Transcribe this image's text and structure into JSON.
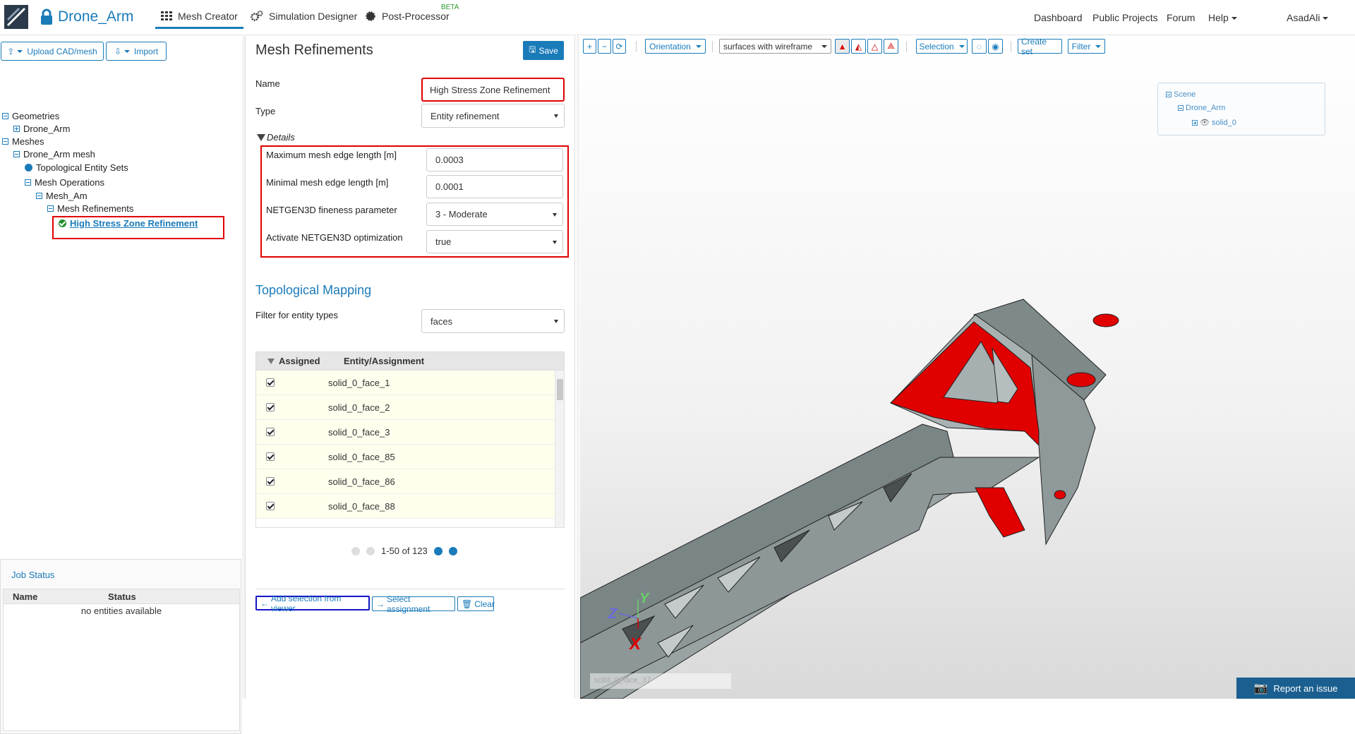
{
  "app": {
    "project_name": "Drone_Arm",
    "tabs": [
      {
        "label": "Mesh Creator",
        "active": true
      },
      {
        "label": "Simulation Designer",
        "active": false
      },
      {
        "label": "Post-Processor",
        "active": false
      }
    ],
    "beta_label": "BETA",
    "right_nav": [
      "Dashboard",
      "Public Projects",
      "Forum",
      "Help",
      "AsadAli"
    ]
  },
  "left_panel": {
    "upload_button": "Upload CAD/mesh",
    "import_button": "Import",
    "tree": {
      "geometries": "Geometries",
      "geometry_item": "Drone_Arm",
      "meshes": "Meshes",
      "mesh_item": "Drone_Arm mesh",
      "topo_sets": "Topological Entity Sets",
      "mesh_operations": "Mesh Operations",
      "mesh_am": "Mesh_Am",
      "mesh_refinements": "Mesh Refinements",
      "selected_refinement": "High Stress Zone Refinement"
    },
    "job_status": {
      "title": "Job Status",
      "columns": [
        "Name",
        "Status"
      ],
      "empty_text": "no entities available"
    }
  },
  "middle_panel": {
    "title": "Mesh Refinements",
    "save_button": "Save",
    "name_label": "Name",
    "name_value": "High Stress Zone Refinement",
    "type_label": "Type",
    "type_value": "Entity refinement",
    "details_label": "Details",
    "details": [
      {
        "label": "Maximum mesh edge length [m]",
        "value": "0.0003",
        "kind": "input"
      },
      {
        "label": "Minimal mesh edge length [m]",
        "value": "0.0001",
        "kind": "input"
      },
      {
        "label": "NETGEN3D fineness parameter",
        "value": "3 - Moderate",
        "kind": "select"
      },
      {
        "label": "Activate NETGEN3D optimization",
        "value": "true",
        "kind": "select"
      }
    ],
    "topological_mapping": "Topological Mapping",
    "filter_label": "Filter for entity types",
    "filter_value": "faces",
    "grid_columns": [
      "Assigned",
      "Entity/Assignment"
    ],
    "grid_rows": [
      {
        "checked": true,
        "entity": "solid_0_face_1"
      },
      {
        "checked": true,
        "entity": "solid_0_face_2"
      },
      {
        "checked": true,
        "entity": "solid_0_face_3"
      },
      {
        "checked": true,
        "entity": "solid_0_face_85"
      },
      {
        "checked": true,
        "entity": "solid_0_face_86"
      },
      {
        "checked": true,
        "entity": "solid_0_face_88"
      }
    ],
    "pager_text": "1-50 of 123",
    "add_selection_button": "Add selection from viewer",
    "select_assignment_button": "Select assignment",
    "clear_button": "Clear"
  },
  "viewer": {
    "orientation_button": "Orientation",
    "render_mode": "surfaces with wireframe",
    "selection_button": "Selection",
    "create_set_button": "Create set",
    "filter_button": "Filter",
    "scene_tree": [
      "Scene",
      "Drone_Arm",
      "solid_0"
    ],
    "hovered_face": "solid_0_face_37",
    "report_button": "Report an issue",
    "axes": {
      "x": "X",
      "y": "Y",
      "z": "Z"
    }
  },
  "colors": {
    "accent": "#1a7bb9",
    "highlight": "#e00000",
    "model_gray": "#7f8c8d"
  }
}
